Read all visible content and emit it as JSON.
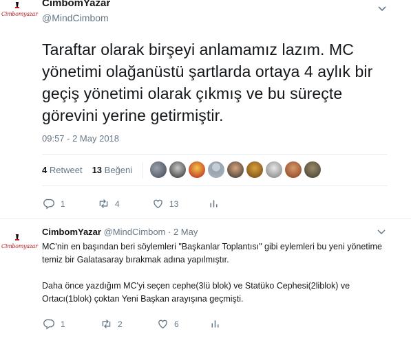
{
  "tweet": {
    "author_name": "CimbomYazar",
    "author_handle": "@MindCimbom",
    "logo_text": "Cimbomyazar",
    "text": "Taraftar olarak birşeyi anlamamız lazım. MC yönetimi olağanüstü şartlarda ortaya 4 aylık bir geçiş yönetimi olarak çıkmış ve bu süreçte görevini yerine getirmiştir.",
    "timestamp": "09:57 - 2 May 2018",
    "retweet_count": "4",
    "retweet_label": "Retweet",
    "like_count": "13",
    "like_label": "Beğeni",
    "actions": {
      "replies": "1",
      "retweets": "4",
      "likes": "13"
    }
  },
  "reply": {
    "author_name": "CimbomYazar",
    "author_handle": "@MindCimbom",
    "date": "· 2 May",
    "logo_text": "Cimbomyazar",
    "paragraph_1": "MC'nin en başından beri söylemleri \"Başkanlar Toplantısı\" gibi eylemleri bu yeni yönetime temiz bir Galatasaray bırakmak adına yapılmıştır.",
    "paragraph_2": "Daha önce yazdığım MC'yi seçen cephe(3lü blok) ve Statüko Cephesi(2liblok) ve Ortacı(1blok) çoktan Yeni Başkan arayışına geçmişti.",
    "actions": {
      "replies": "1",
      "retweets": "2",
      "likes": "6"
    }
  },
  "icons": {
    "reply": "reply-icon",
    "retweet": "retweet-icon",
    "like": "heart-icon",
    "analytics": "analytics-icon",
    "more": "chevron-down-icon"
  },
  "colors": {
    "text": "#14171a",
    "secondary": "#657786",
    "divider": "#e6ecf0",
    "logo_red": "#c0171f"
  }
}
